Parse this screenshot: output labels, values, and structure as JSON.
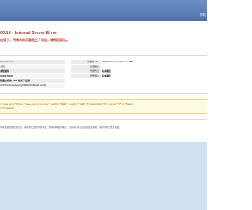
{
  "header": {
    "link_text": "帮助"
  },
  "error": {
    "title": "00.19 - Internal Server Error",
    "subtitle": "出错了，所请求的页面发生了错误，请稍后再试。"
  },
  "details": {
    "left_rows": [
      {
        "text": "IIS Web Core",
        "bold": false
      },
      {
        "text": "未知",
        "bold": false
      },
      {
        "text": "未知模块",
        "bold": true
      },
      {
        "text": "0x80070005",
        "bold": true
      },
      {
        "text": "配置文件的 XML 格式不正确",
        "bold": true
      },
      {
        "text": "C:\\PS\\web\\webconfig\\WEB\\WEB\\web.config",
        "bold": false
      }
    ],
    "right_rows": [
      {
        "label": "请求的 URL",
        "value": "http://www.yoursite.com:80/"
      },
      {
        "label": "物理路径",
        "value": ""
      },
      {
        "label": "登录方法",
        "value": "尚未确定"
      },
      {
        "label": "登录用户",
        "value": "尚未确定"
      }
    ]
  },
  "config_source": {
    "lines": [
      "<frame src=\"https://www.yoursite.com/\" width=\"100%\" height=\"100%\" frameborder=\"0\" border=\"0\"></frame>",
      "</frameset>"
    ]
  },
  "footer": {
    "text": "有关此错误的更多信息，请检查配置文件的语法，或联系网站管理员。要获得有关此错误的更多帮助，请访问相关支持页面。"
  },
  "colors": {
    "header_bg": "#5c80b8",
    "error_title": "#b03a2e",
    "lower_panel": "#cfe0f1",
    "code_bg": "#fffbe0"
  }
}
